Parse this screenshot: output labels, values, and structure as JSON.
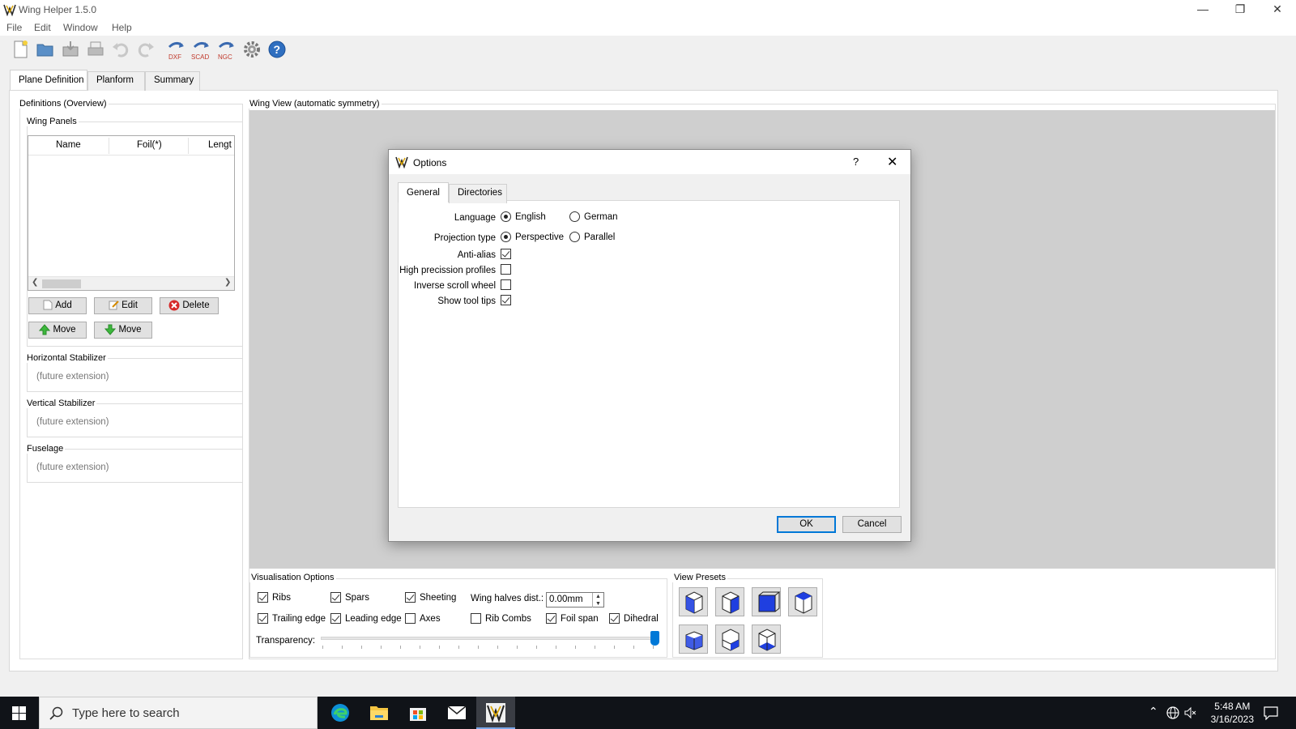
{
  "window": {
    "title": "Wing Helper 1.5.0",
    "controls": {
      "minimize": "—",
      "restore": "❐",
      "close": "✕"
    }
  },
  "menu": [
    "File",
    "Edit",
    "Window",
    "Help"
  ],
  "toolbar": {
    "icons": [
      "new-file-icon",
      "open-folder-icon",
      "save-icon",
      "print-icon",
      "undo-icon",
      "redo-icon",
      "export-dxf-icon",
      "export-scad-icon",
      "export-ngc-icon",
      "settings-gear-icon",
      "help-icon"
    ],
    "labels": {
      "dxf": "DXF",
      "scad": "SCAD",
      "ngc": "NGC",
      "help": "?"
    }
  },
  "main_tabs": [
    "Plane Definition",
    "Planform",
    "Summary"
  ],
  "definitions": {
    "title": "Definitions (Overview)",
    "wing_panels": {
      "title": "Wing Panels",
      "columns": [
        "Name",
        "Foil(*)",
        "Lengt"
      ],
      "buttons": {
        "add": "Add",
        "edit": "Edit",
        "delete": "Delete",
        "move_up": "Move",
        "move_down": "Move"
      }
    },
    "horizontal_stabilizer": {
      "title": "Horizontal Stabilizer",
      "placeholder": "(future extension)"
    },
    "vertical_stabilizer": {
      "title": "Vertical Stabilizer",
      "placeholder": "(future extension)"
    },
    "fuselage": {
      "title": "Fuselage",
      "placeholder": "(future extension)"
    }
  },
  "wing_view": {
    "title": "Wing View (automatic symmetry)"
  },
  "visualisation": {
    "title": "Visualisation Options",
    "row1": [
      {
        "label": "Ribs",
        "checked": true
      },
      {
        "label": "Spars",
        "checked": true
      },
      {
        "label": "Sheeting",
        "checked": true
      }
    ],
    "row2": [
      {
        "label": "Trailing edge",
        "checked": true
      },
      {
        "label": "Leading edge",
        "checked": true
      },
      {
        "label": "Axes",
        "checked": false
      },
      {
        "label": "Rib Combs",
        "checked": false
      },
      {
        "label": "Foil span",
        "checked": true
      },
      {
        "label": "Dihedral",
        "checked": true
      }
    ],
    "wing_halves_label": "Wing halves dist.:",
    "wing_halves_value": "0.00mm",
    "transparency_label": "Transparency:",
    "transparency_value": 1.0
  },
  "view_presets": {
    "title": "View Presets",
    "count": 7
  },
  "options_dialog": {
    "title": "Options",
    "help": "?",
    "close": "✕",
    "tabs": [
      "General",
      "Directories"
    ],
    "language_label": "Language",
    "language_options": [
      "English",
      "German"
    ],
    "language_selected": "English",
    "projection_label": "Projection type",
    "projection_options": [
      "Perspective",
      "Parallel"
    ],
    "projection_selected": "Perspective",
    "checkboxes": [
      {
        "label": "Anti-alias",
        "checked": true
      },
      {
        "label": "High precission profiles",
        "checked": false
      },
      {
        "label": "Inverse scroll wheel",
        "checked": false
      },
      {
        "label": "Show tool tips",
        "checked": true
      }
    ],
    "ok": "OK",
    "cancel": "Cancel"
  },
  "taskbar": {
    "search_placeholder": "Type here to search",
    "time": "5:48 AM",
    "date": "3/16/2023",
    "apps": [
      "edge-icon",
      "file-explorer-icon",
      "store-icon",
      "mail-icon",
      "wing-helper-icon"
    ]
  },
  "colors": {
    "accent": "#0078d7",
    "viewport_bg": "#cfcfcf",
    "taskbar_bg": "#101318",
    "preset_face": "#1f3fe0"
  }
}
